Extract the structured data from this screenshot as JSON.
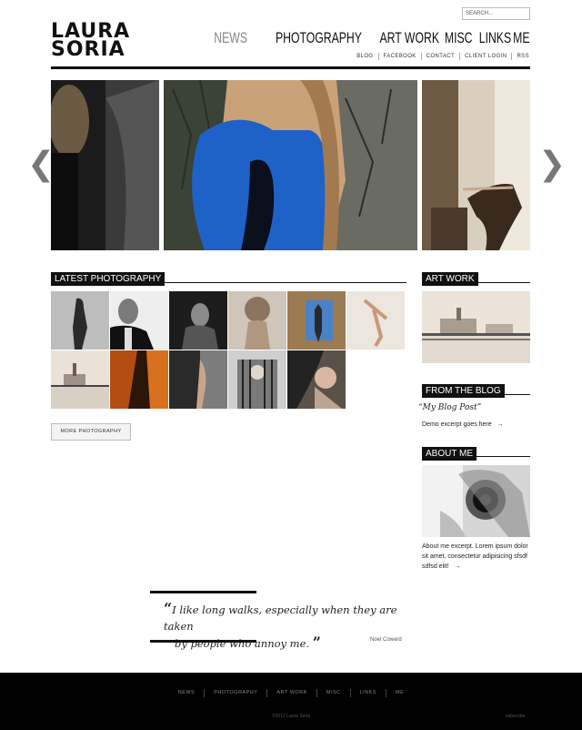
{
  "header": {
    "logo_line1": "LAURA",
    "logo_line2": "SORIA",
    "search_placeholder": "SEARCH...",
    "main_nav": [
      "NEWS",
      "PHOTOGRAPHY",
      "ART WORK",
      "MISC",
      "LINKS",
      "ME"
    ],
    "active_nav": "NEWS",
    "sub_nav": [
      "BLOG",
      "FACEBOOK",
      "CONTACT",
      "CLIENT LOGIN",
      "RSS"
    ]
  },
  "slider": {
    "prev_icon": "chevron-left-icon",
    "next_icon": "chevron-right-icon",
    "prev_glyph": "❮",
    "next_glyph": "❯"
  },
  "latest": {
    "heading": "LATEST PHOTOGRAPHY",
    "button": "MORE PHOTOGRAPHY"
  },
  "sidebar": {
    "art_heading": "ART WORK",
    "blog_heading": "FROM THE BLOG",
    "blog_post_title": "“My Blog Post”",
    "blog_excerpt": "Demo excerpt goes here",
    "arrow": "→",
    "about_heading": "ABOUT ME",
    "about_text": "About me excerpt. Lorem ipsum dolor sit amet, consectetur adipisicing sfsdf sdfsd elit!"
  },
  "quote": {
    "open_mark": "“",
    "close_mark": "”",
    "text_line1": "I like long walks, especially when they are taken",
    "text_line2": "by people who annoy me.",
    "author": "Noel Coward"
  },
  "footer": {
    "nav": [
      "NEWS",
      "PHOTOGRAPHY",
      "ART WORK",
      "MISC",
      "LINKS",
      "ME"
    ],
    "copyright": "©2012 Laura Soria",
    "subscribe": "subscribe"
  },
  "colors": {
    "accent_blue": "#1e62c8",
    "header_bar": "#111111",
    "footer_bg": "#000000"
  }
}
